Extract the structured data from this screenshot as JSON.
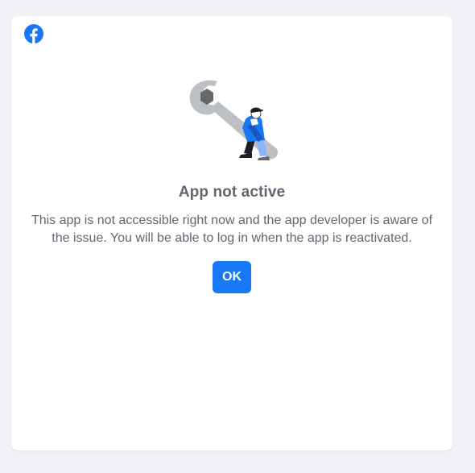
{
  "dialog": {
    "logo_icon": "facebook-icon",
    "illustration_icon": "wrench-mechanic-illustration",
    "title": "App not active",
    "message": "This app is not accessible right now and the app developer is aware of the issue. You will be able to log in when the app is reactivated.",
    "ok_label": "OK"
  },
  "colors": {
    "page_background": "#f0f2f5",
    "card_background": "#ffffff",
    "text": "#606770",
    "brand_blue": "#1877f2",
    "wrench_gray": "#bcc0c4"
  }
}
